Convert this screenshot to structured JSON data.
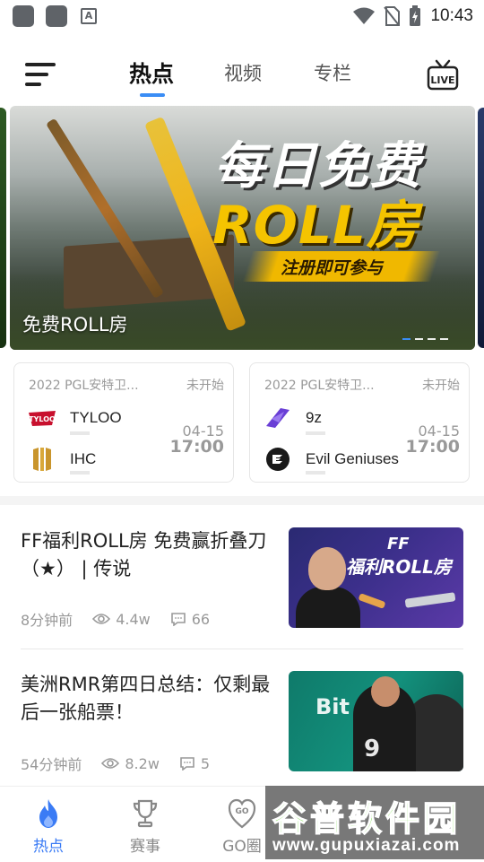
{
  "status_bar": {
    "time": "10:43",
    "notification_icon_letter": "A"
  },
  "top_nav": {
    "tabs": [
      {
        "label": "热点",
        "active": true
      },
      {
        "label": "视频",
        "active": false
      },
      {
        "label": "专栏",
        "active": false
      }
    ],
    "live_label": "LIVE"
  },
  "banner": {
    "headline_line1": "每日免费",
    "headline_line2": "ROLL房",
    "subline": "注册即可参与",
    "caption": "免费ROLL房",
    "dot_count": 4,
    "active_dot": 0
  },
  "matches": [
    {
      "league": "2022 PGL安特卫...",
      "status": "未开始",
      "team1": {
        "name": "TYLOO",
        "logo": "tyloo-logo"
      },
      "team2": {
        "name": "IHC",
        "logo": "ihc-logo"
      },
      "date": "04-15",
      "time": "17:00"
    },
    {
      "league": "2022 PGL安特卫...",
      "status": "未开始",
      "team1": {
        "name": "9z",
        "logo": "9z-logo"
      },
      "team2": {
        "name": "Evil Geniuses",
        "logo": "evil-geniuses-logo"
      },
      "date": "04-15",
      "time": "17:00"
    }
  ],
  "news": [
    {
      "title": "FF福利ROLL房  免费赢折叠刀（★） | 传说",
      "time_ago": "8分钟前",
      "views": "4.4w",
      "comments": "66",
      "thumb_text_1": "FF",
      "thumb_text_2": "福利ROLL房"
    },
    {
      "title": "美洲RMR第四日总结：仅剩最后一张船票！",
      "time_ago": "54分钟前",
      "views": "8.2w",
      "comments": "5",
      "thumb_text_1": "Bit",
      "thumb_text_2": "9"
    }
  ],
  "bottom_nav": {
    "items": [
      {
        "label": "热点",
        "icon": "flame-icon",
        "active": true
      },
      {
        "label": "赛事",
        "icon": "trophy-icon",
        "active": false
      },
      {
        "label": "GO圈",
        "icon": "go-circle-icon",
        "active": false
      }
    ]
  },
  "watermark": {
    "brand": "谷普软件园",
    "url": "www.gupuxiazai.com"
  },
  "colors": {
    "accent": "#3a8df5",
    "nav_active": "#3a7bf5",
    "muted": "#999999"
  }
}
